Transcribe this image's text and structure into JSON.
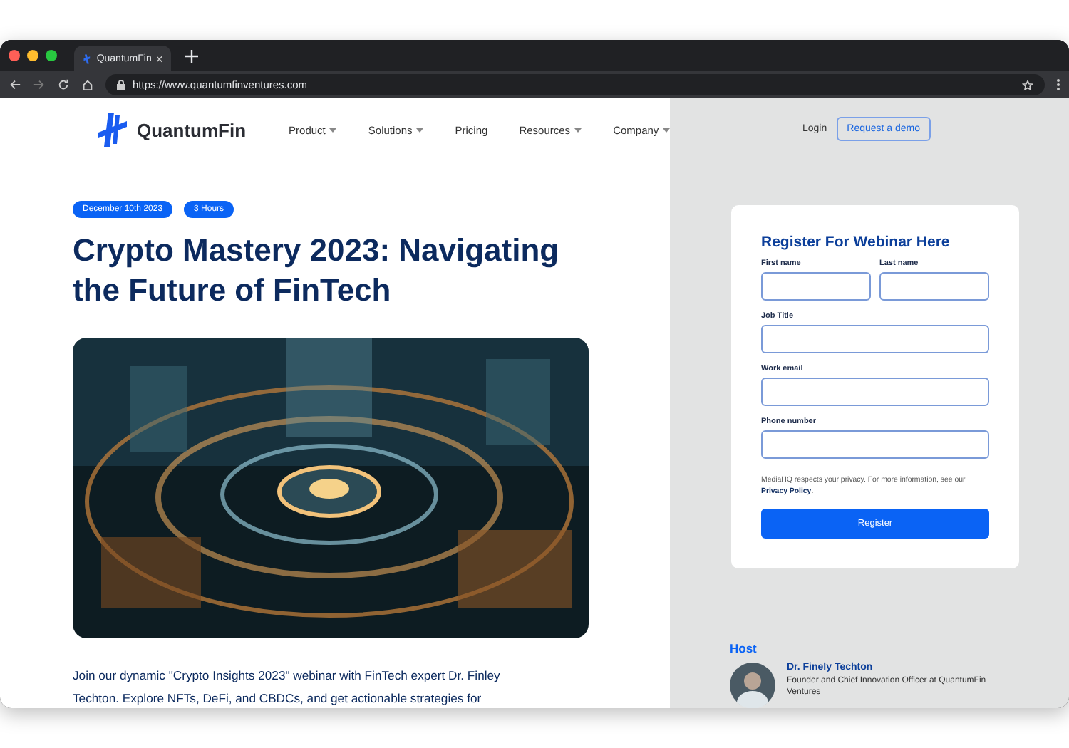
{
  "browser": {
    "tab_title": "QuantumFin",
    "url": "https://www.quantumfinventures.com"
  },
  "nav": {
    "brand": "QuantumFin",
    "items": [
      {
        "label": "Product",
        "dropdown": true
      },
      {
        "label": "Solutions",
        "dropdown": true
      },
      {
        "label": "Pricing",
        "dropdown": false
      },
      {
        "label": "Resources",
        "dropdown": true
      },
      {
        "label": "Company",
        "dropdown": true
      }
    ],
    "login": "Login",
    "demo_button": "Request a demo"
  },
  "event": {
    "badges": [
      "December 10th 2023",
      "3 Hours"
    ],
    "title": "Crypto Mastery 2023: Navigating the Future of FinTech",
    "description": "Join our dynamic \"Crypto Insights 2023\" webinar with FinTech expert Dr. Finley Techton. Explore NFTs, DeFi, and CBDCs, and get actionable strategies for"
  },
  "form": {
    "title": "Register For Webinar Here",
    "fields": [
      {
        "label": "First name",
        "half": true
      },
      {
        "label": "Last name",
        "half": true
      },
      {
        "label": "Job Title",
        "half": false
      },
      {
        "label": "Work email",
        "half": false
      },
      {
        "label": "Phone number",
        "half": false
      }
    ],
    "privacy_text": "MediaHQ respects your privacy. For more information, see our",
    "privacy_link": "Privacy Policy",
    "privacy_end": ".",
    "submit": "Register"
  },
  "host": {
    "heading": "Host",
    "name": "Dr. Finely Techton",
    "role": "Founder and Chief Innovation Officer at QuantumFin Ventures"
  }
}
